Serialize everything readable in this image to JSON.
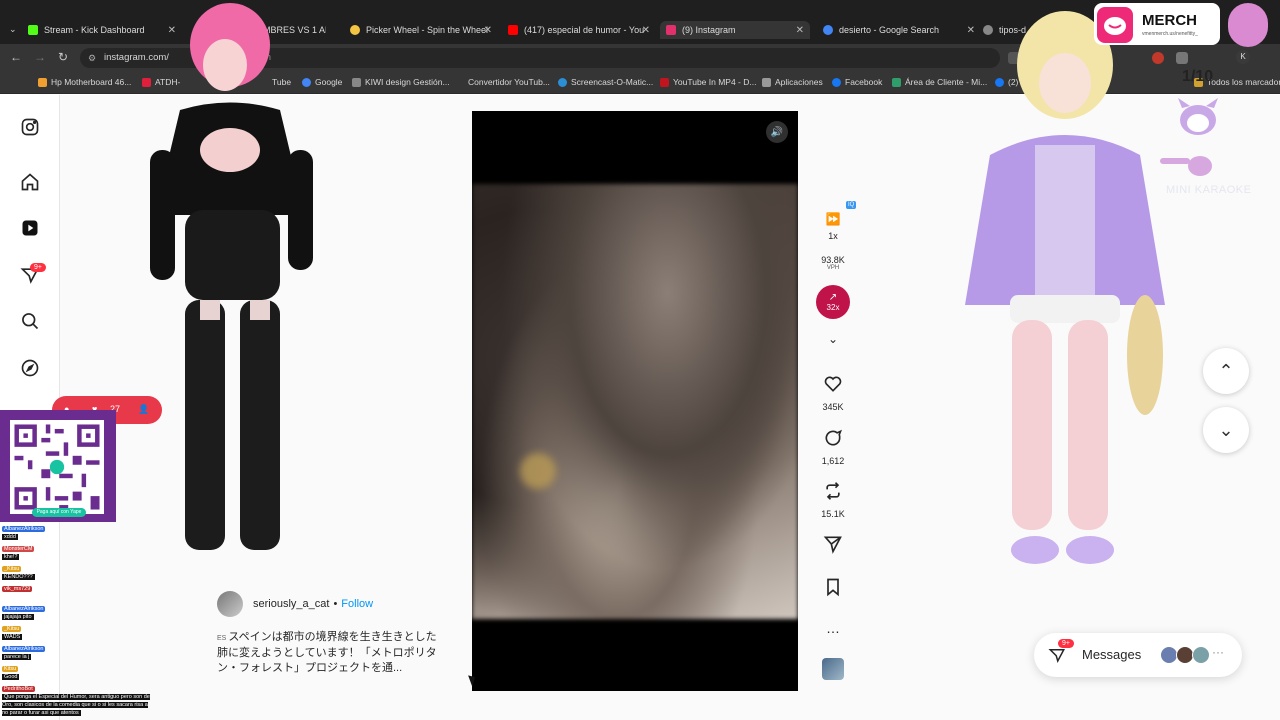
{
  "browser": {
    "tabs": [
      {
        "title": "Stream - Kick Dashboard",
        "color": "#53fc18"
      },
      {
        "title": "OMBRES VS 1 ARTIS",
        "color": "#ff3b3b"
      },
      {
        "title": "Picker Wheel - Spin the Wheel",
        "color": "#f4c542"
      },
      {
        "title": "(417) especial de humor - You",
        "color": "#ff0000"
      },
      {
        "title": "(9) Instagram",
        "color": "#e1306c"
      },
      {
        "title": "desierto - Google Search",
        "color": "#4285f4"
      },
      {
        "title": "tipos-d",
        "color": "#888888"
      }
    ],
    "url": "instagram.com/",
    "url_tail": "reen",
    "bookmarks": [
      "Hp Motherboard 46...",
      "ATDH-",
      "Tube",
      "Google",
      "KIWI design Gestión...",
      "Convertidor YouTub...",
      "Screencast-O-Matic...",
      "YouTube In MP4 - D...",
      "Aplicaciones",
      "Facebook",
      "Área de Cliente - Mi...",
      "(2)",
      "Todos los marcadores"
    ],
    "profile_initial": "K"
  },
  "instagram": {
    "rail_badge": "9+",
    "author": "seriously_a_cat",
    "follow_label": "Follow",
    "separator": "•",
    "caption_lang": "ES",
    "caption": "スペインは都市の境界線を生き生きとした肺に変えようとしています！「メトロポリタン・フォレスト」プロジェクトを通...",
    "actions": {
      "speed": "1x",
      "iq": "IQ",
      "vph_value": "93.8K",
      "vph_unit": "VPH",
      "boost": "32x",
      "likes": "345K",
      "comments": "1,612",
      "reposts": "15.1K"
    },
    "messages_label": "Messages",
    "messages_badge": "9+"
  },
  "overlay": {
    "merch_title": "MERCH",
    "merch_sub": "vmenmerch.us/nenefitty_",
    "counter": "1/10",
    "karaoke": "MINI KARAOKE",
    "qr_label": "Paga aquí con Yape",
    "redpill_count": "27",
    "chat": [
      {
        "user": "AlbanezAlrikson",
        "msg": "xddd",
        "color": "#2d6cdf"
      },
      {
        "user": "MonsterCM",
        "msg": "khe!?",
        "color": "#d04a4a"
      },
      {
        "user": "_Kitsu",
        "msg": "KENDO???",
        "color": "#e0a21f"
      },
      {
        "user": "vik_ms729",
        "msg": "",
        "color": "#c03030"
      },
      {
        "user": "AlbanezAlrikson",
        "msg": "jajajaja pito",
        "color": "#2d6cdf"
      },
      {
        "user": "_Kitsu",
        "msg": "WADS",
        "color": "#e0a21f"
      },
      {
        "user": "AlbanezAlrikson",
        "msg": "parece la j",
        "color": "#2d6cdf"
      },
      {
        "user": "Kitsu",
        "msg": "Good",
        "color": "#e0a21f"
      },
      {
        "user": "PedrithoBot",
        "msg": "Que ponga el Especial del Humor, sera antiguo pero son de Oro, son clasicos de la comedia que si o si les sacara risa a no parar o furar asi que atentos",
        "color": "#c03030"
      }
    ]
  }
}
